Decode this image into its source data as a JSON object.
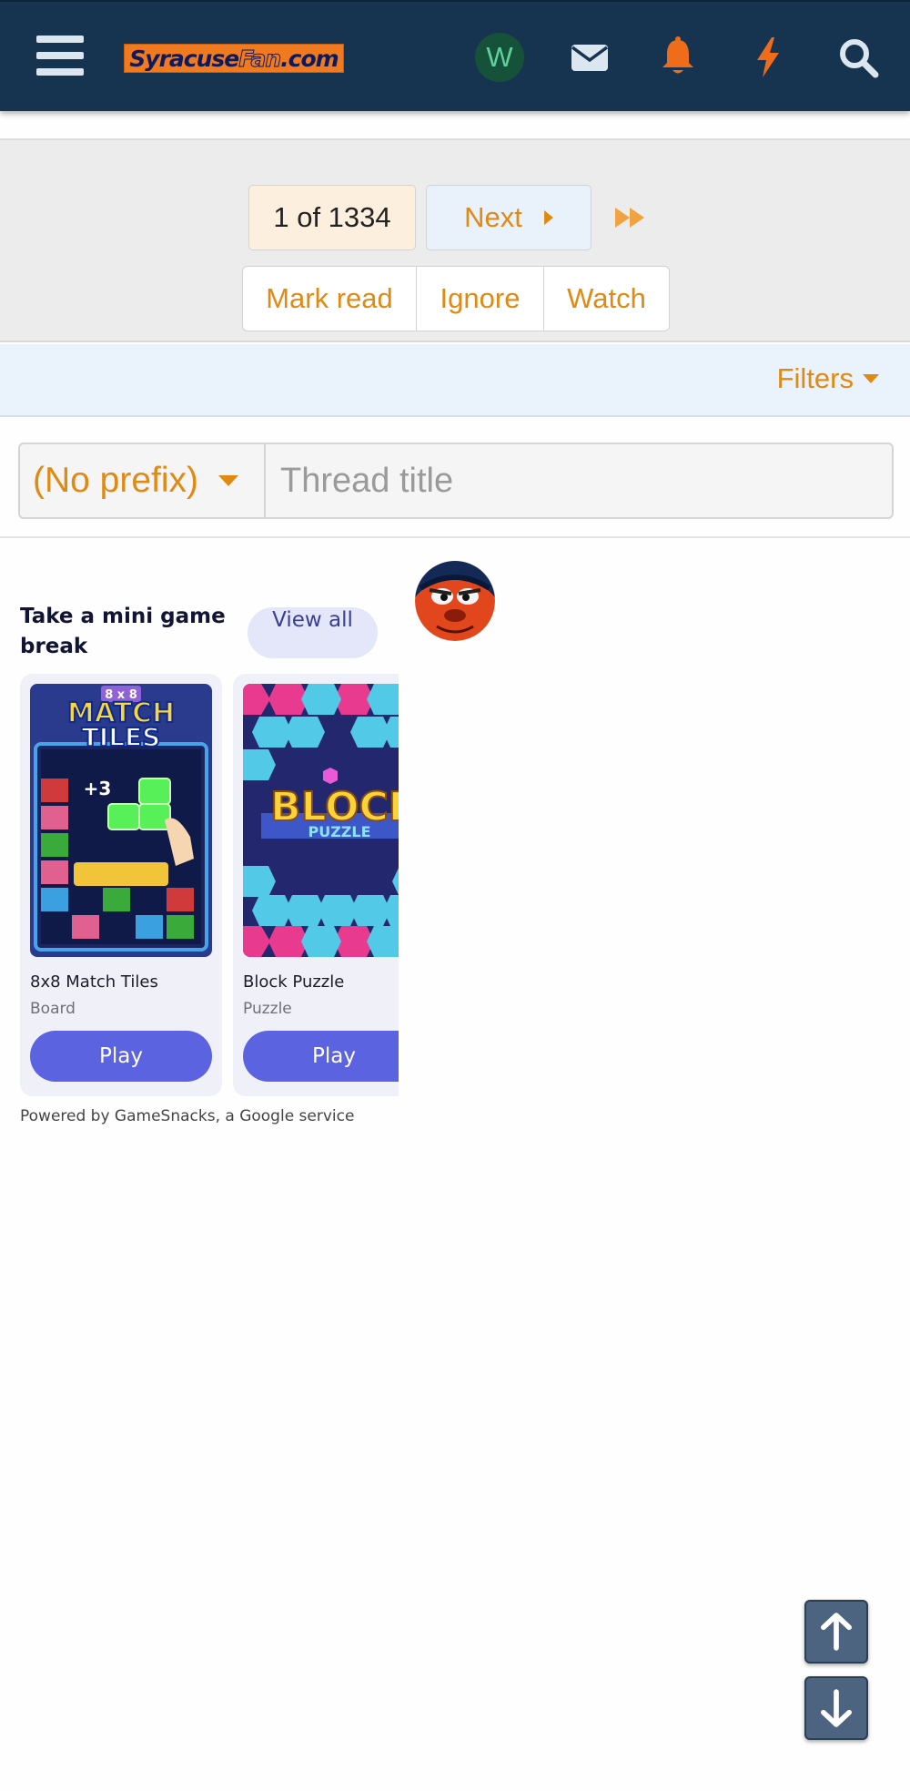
{
  "header": {
    "logo_text_1": "Syracuse",
    "logo_text_2": "Fan",
    "logo_text_3": ".com",
    "user_initial": "W",
    "icons": [
      "menu-icon",
      "envelope-icon",
      "bell-icon",
      "bolt-icon",
      "search-icon"
    ]
  },
  "pager": {
    "page_label": "1 of 1334",
    "next_label": "Next",
    "mark_read": "Mark read",
    "ignore": "Ignore",
    "watch": "Watch"
  },
  "filters": {
    "label": "Filters"
  },
  "thread_form": {
    "prefix": "(No prefix)",
    "title_placeholder": "Thread title"
  },
  "games": {
    "title": "Take a mini game break",
    "view_all": "View all",
    "cards": [
      {
        "name": "8x8 Match Tiles",
        "category": "Board",
        "play": "Play",
        "art_text_1": "8 x 8",
        "art_text_2": "MATCH",
        "art_text_3": "TILES",
        "art_text_4": "+3"
      },
      {
        "name": "Block Puzzle",
        "category": "Puzzle",
        "play": "Play",
        "art_text_1": "BLOCK",
        "art_text_2": "PUZZLE"
      }
    ],
    "powered_by": "Powered by GameSnacks, a Google service"
  },
  "colors": {
    "header_bg": "#163450",
    "accent_orange": "#df8a13",
    "play_button": "#5b63e0",
    "scroll_button": "#4c6480"
  }
}
